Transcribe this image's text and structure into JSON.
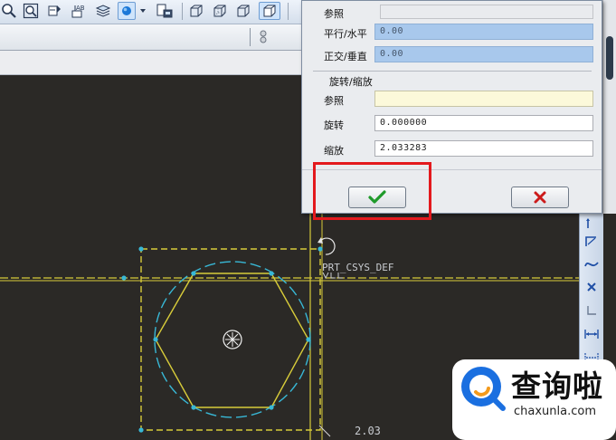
{
  "toolbar": {
    "icons": [
      "zoom-in-icon",
      "zoom-window-icon",
      "repaint-icon",
      "abc-display-icon",
      "layers-icon",
      "view-style-icon",
      "dropdown-icon",
      "saved-view-icon",
      "shading-icon",
      "hidden-line-icon",
      "no-hidden-icon",
      "wireframe-icon"
    ]
  },
  "dialog": {
    "ref_top_label": "参照",
    "parallel_label": "平行/水平",
    "parallel_value": "0.00",
    "ortho_label": "正交/垂直",
    "ortho_value": "0.00",
    "rotate_scale_group": "旋转/缩放",
    "ref_label": "参照",
    "ref_value": "",
    "rotate_label": "旋转",
    "rotate_value": "0.000000",
    "scale_label": "缩放",
    "scale_value": "2.033283"
  },
  "canvas": {
    "csys_label": "PRT_CSYS_DEF",
    "dim_value": "2.03"
  },
  "watermark": {
    "title": "查询啦",
    "url": "chaxunla.com"
  },
  "colors": {
    "sketch_line": "#d8cc3a",
    "vertex": "#38b8d6",
    "highlight": "#e3191d",
    "accept": "#1f9a2a",
    "cancel": "#cc1b1b"
  }
}
